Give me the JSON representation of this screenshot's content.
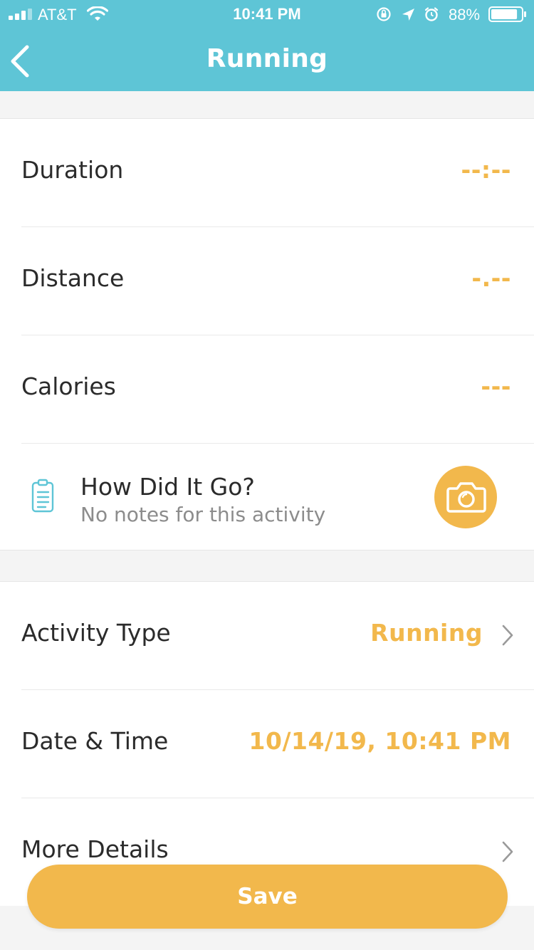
{
  "status_bar": {
    "carrier": "AT&T",
    "time": "10:41 PM",
    "battery_percent": "88%",
    "battery_level": 0.88,
    "icons": [
      "signal-bars-icon",
      "wifi-icon",
      "orientation-lock-icon",
      "location-arrow-icon",
      "alarm-icon",
      "battery-icon"
    ]
  },
  "nav": {
    "title": "Running",
    "back_icon": "chevron-left-icon"
  },
  "metrics": [
    {
      "label": "Duration",
      "value": "--:--"
    },
    {
      "label": "Distance",
      "value": "-.--"
    },
    {
      "label": "Calories",
      "value": "---"
    }
  ],
  "notes": {
    "title": "How Did It Go?",
    "subtitle": "No notes for this activity",
    "icon": "clipboard-icon",
    "camera_icon": "camera-icon"
  },
  "details": {
    "activity_type_label": "Activity Type",
    "activity_type_value": "Running",
    "date_time_label": "Date & Time",
    "date_time_value": "10/14/19, 10:41 PM",
    "more_details_label": "More Details"
  },
  "save_label": "Save",
  "colors": {
    "header": "#5ec5d6",
    "accent": "#f2b84c",
    "background": "#f4f4f4",
    "text": "#2b2b2b",
    "subtext": "#8c8c8c"
  }
}
